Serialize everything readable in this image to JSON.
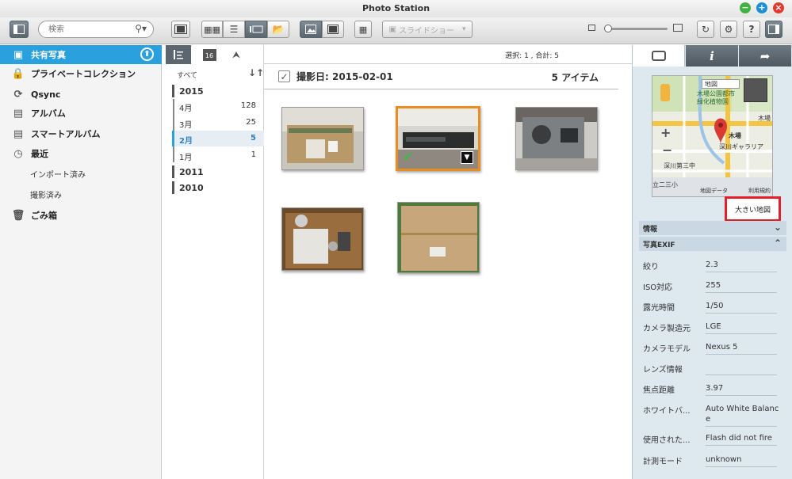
{
  "window": {
    "title": "Photo Station"
  },
  "toolbar": {
    "search_placeholder": "検索",
    "slideshow_label": "スライドショー"
  },
  "sidebar": {
    "items": [
      {
        "label": "共有写真"
      },
      {
        "label": "プライベートコレクション"
      },
      {
        "label": "Qsync"
      },
      {
        "label": "アルバム"
      },
      {
        "label": "スマートアルバム"
      },
      {
        "label": "最近"
      }
    ],
    "recent_sub": [
      "インポート済み",
      "撮影済み"
    ],
    "trash_label": "ごみ箱"
  },
  "timeline": {
    "all_label": "すべて",
    "years": [
      "2015",
      "2011",
      "2010"
    ],
    "months": [
      {
        "label": "4月",
        "count": "128"
      },
      {
        "label": "3月",
        "count": "25"
      },
      {
        "label": "2月",
        "count": "5"
      },
      {
        "label": "1月",
        "count": "1"
      }
    ]
  },
  "main": {
    "selection_info": "選択: 1 , 合計: 5",
    "date_header": "撮影日: 2015-02-01",
    "item_count": "5 アイテム"
  },
  "right_panel": {
    "map": {
      "type_label": "地図",
      "label_park": "木場公園都市\n緑化植物園",
      "label_kiba": "木場",
      "label_gallery": "深川ギャラリア",
      "label_kiba_small": "木場",
      "label_school": "深川第三中",
      "label_elem": "立二三小",
      "footer_data": "地図データ",
      "footer_terms": "利用規約"
    },
    "big_map_label": "大きい地図",
    "info_section": "情報",
    "exif_section": "写真EXIF",
    "exif": [
      {
        "key": "絞り",
        "value": "2.3"
      },
      {
        "key": "ISO対応",
        "value": "255"
      },
      {
        "key": "露光時間",
        "value": "1/50"
      },
      {
        "key": "カメラ製造元",
        "value": "LGE"
      },
      {
        "key": "カメラモデル",
        "value": "Nexus 5"
      },
      {
        "key": "レンズ情報",
        "value": ""
      },
      {
        "key": "焦点距離",
        "value": "3.97"
      },
      {
        "key": "ホワイトバ...",
        "value": "Auto White Balance"
      },
      {
        "key": "使用された...",
        "value": "Flash did not fire"
      },
      {
        "key": "計測モード",
        "value": "unknown"
      }
    ]
  }
}
